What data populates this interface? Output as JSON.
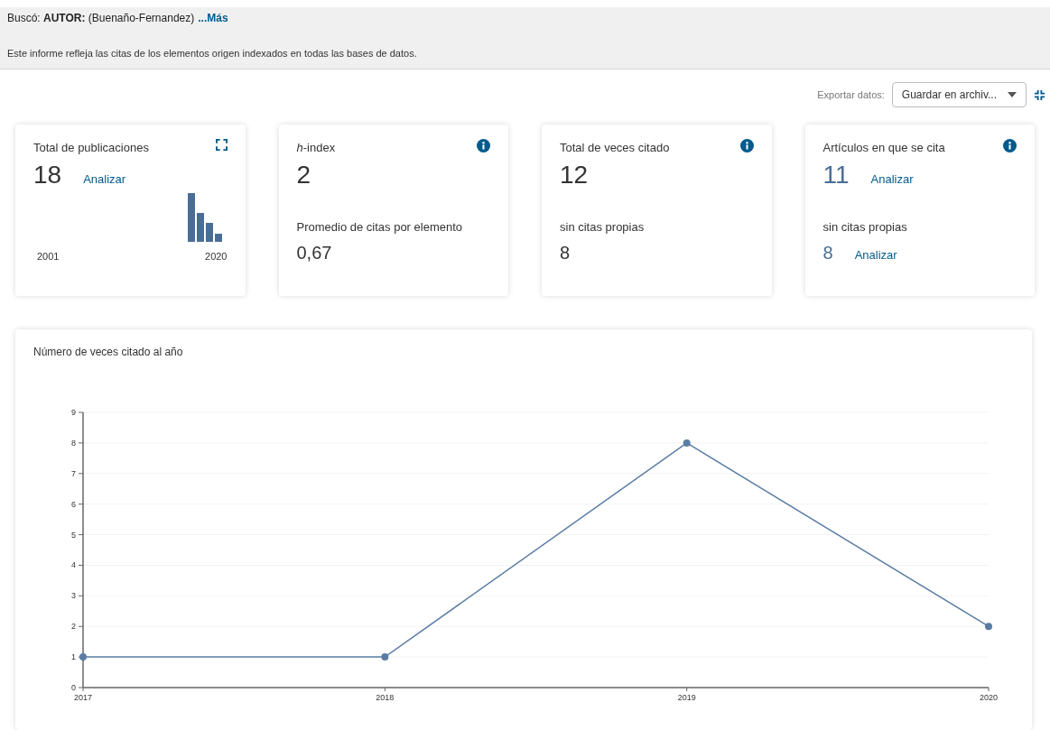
{
  "search_summary": {
    "text": "Buscó: **AUTOR:** (Buenaño-Fernandez)",
    "more_link": "...Más"
  },
  "description": "Este informe refleja las citas de los elementos origen indexados en todas las bases de datos.",
  "export": {
    "label": "Exportar datos:",
    "value": "Guardar en archiv..."
  },
  "cards": [
    {
      "kind": "publications",
      "title": "Total de publicaciones",
      "value": "18",
      "link": "Analizar",
      "range_start": "2001",
      "range_end": "2020"
    },
    {
      "kind": "metric",
      "title": "*h*-index",
      "value": "2",
      "sub_label": "Promedio de citas por elemento",
      "sub_value": "0,67"
    },
    {
      "kind": "metric",
      "title": "Total de veces citado",
      "value": "12",
      "sub_label": "sin citas propias",
      "sub_value": "8"
    },
    {
      "kind": "citing",
      "title": "Artículos en que se cita",
      "value": "11",
      "link": "Analizar",
      "sub_label": "sin citas propias",
      "sub_value": "8",
      "sub_link": "Analizar"
    }
  ],
  "chart": {
    "title": "Número de veces citado al año",
    "chart_data": {
      "type": "line",
      "x": [
        "2017",
        "2018",
        "2019",
        "2020"
      ],
      "series": [
        {
          "color": "#5a7ca3",
          "marker": true,
          "values": [
            1,
            1,
            8,
            2
          ]
        }
      ],
      "grid": true,
      "ylim": [
        0,
        9
      ],
      "yticks": [
        0,
        1,
        2,
        3,
        4,
        5,
        6,
        7,
        8,
        9
      ]
    }
  }
}
